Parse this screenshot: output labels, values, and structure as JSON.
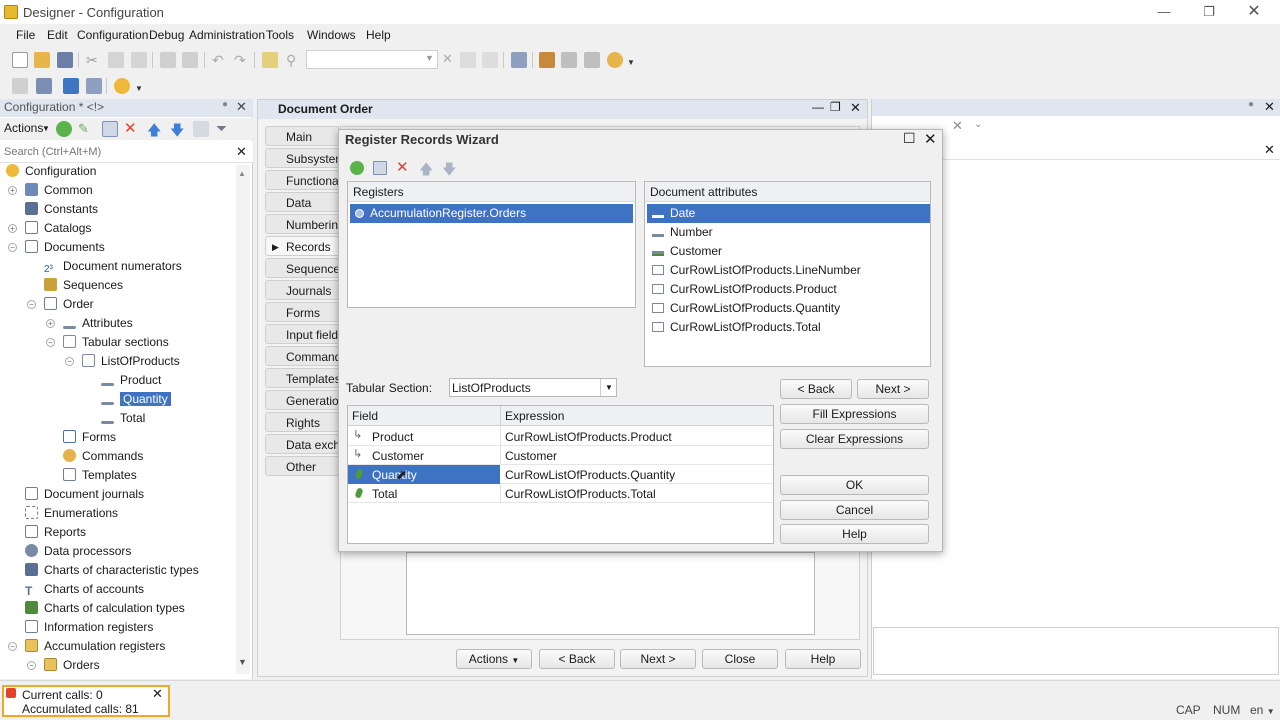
{
  "window": {
    "title": "Designer - Configuration",
    "controls": [
      "minimize-icon",
      "restore-icon",
      "close-icon"
    ]
  },
  "menu": {
    "items": [
      {
        "label": "File"
      },
      {
        "label": "Edit"
      },
      {
        "label": "Configuration"
      },
      {
        "label": "Debug"
      },
      {
        "label": "Administration"
      },
      {
        "label": "Tools"
      },
      {
        "label": "Windows"
      },
      {
        "label": "Help"
      }
    ]
  },
  "config_panel": {
    "title": "Configuration * <!>",
    "actions_label": "Actions",
    "search_placeholder": "Search (Ctrl+Alt+M)",
    "tree": [
      {
        "label": "Configuration",
        "icon": "configuration-icon"
      },
      {
        "label": "Common",
        "icon": "common-icon"
      },
      {
        "label": "Constants",
        "icon": "constants-icon"
      },
      {
        "label": "Catalogs",
        "icon": "catalogs-icon"
      },
      {
        "label": "Documents",
        "icon": "documents-icon"
      },
      {
        "label": "Document numerators",
        "icon": "numerator-icon"
      },
      {
        "label": "Sequences",
        "icon": "sequences-icon"
      },
      {
        "label": "Order",
        "icon": "document-icon"
      },
      {
        "label": "Attributes",
        "icon": "attribute-icon"
      },
      {
        "label": "Tabular sections",
        "icon": "tabular-icon"
      },
      {
        "label": "ListOfProducts",
        "icon": "tabular-icon"
      },
      {
        "label": "Product",
        "icon": "attribute-icon"
      },
      {
        "label": "Quantity",
        "icon": "attribute-icon"
      },
      {
        "label": "Total",
        "icon": "attribute-icon"
      },
      {
        "label": "Forms",
        "icon": "forms-icon"
      },
      {
        "label": "Commands",
        "icon": "commands-icon"
      },
      {
        "label": "Templates",
        "icon": "templates-icon"
      },
      {
        "label": "Document journals",
        "icon": "journal-icon"
      },
      {
        "label": "Enumerations",
        "icon": "enumeration-icon"
      },
      {
        "label": "Reports",
        "icon": "report-icon"
      },
      {
        "label": "Data processors",
        "icon": "processor-icon"
      },
      {
        "label": "Charts of characteristic types",
        "icon": "chart-char-icon"
      },
      {
        "label": "Charts of accounts",
        "icon": "chart-accounts-icon"
      },
      {
        "label": "Charts of calculation types",
        "icon": "chart-calc-icon"
      },
      {
        "label": "Information registers",
        "icon": "info-register-icon"
      },
      {
        "label": "Accumulation registers",
        "icon": "accum-register-icon"
      },
      {
        "label": "Orders",
        "icon": "accum-register-icon"
      }
    ]
  },
  "document_panel": {
    "title": "Document Order",
    "tabs": [
      "Main",
      "Subsystems",
      "Functional",
      "Data",
      "Numbering",
      "Records",
      "Sequences",
      "Journals",
      "Forms",
      "Input fields",
      "Commands",
      "Templates",
      "Generation",
      "Rights",
      "Data exchange",
      "Other"
    ],
    "active_tab": "Records",
    "buttons": {
      "actions": "Actions",
      "back": "< Back",
      "next": "Next >",
      "close": "Close",
      "help": "Help"
    }
  },
  "wizard": {
    "title": "Register Records Wizard",
    "registers_header": "Registers",
    "registers": [
      "AccumulationRegister.Orders"
    ],
    "attributes_header": "Document attributes",
    "attributes": [
      "Date",
      "Number",
      "Customer",
      "CurRowListOfProducts.LineNumber",
      "CurRowListOfProducts.Product",
      "CurRowListOfProducts.Quantity",
      "CurRowListOfProducts.Total"
    ],
    "tabular_section_label": "Tabular Section:",
    "tabular_section_value": "ListOfProducts",
    "grid_headers": {
      "field": "Field",
      "expression": "Expression"
    },
    "grid_rows": [
      {
        "field": "Product",
        "expression": "CurRowListOfProducts.Product"
      },
      {
        "field": "Customer",
        "expression": "Customer"
      },
      {
        "field": "Quantity",
        "expression": "CurRowListOfProducts.Quantity"
      },
      {
        "field": "Total",
        "expression": "CurRowListOfProducts.Total"
      }
    ],
    "buttons": {
      "back": "< Back",
      "next": "Next >",
      "fill": "Fill Expressions",
      "clear": "Clear Expressions",
      "ok": "OK",
      "cancel": "Cancel",
      "help": "Help"
    }
  },
  "status": {
    "current_calls": "Current calls: 0",
    "accumulated_calls": "Accumulated calls: 81",
    "indicators": [
      "CAP",
      "NUM",
      "en"
    ]
  },
  "colors": {
    "selection": "#3e73c4",
    "panel_header": "#dfe6ef",
    "accent_orange": "#f5a623"
  }
}
